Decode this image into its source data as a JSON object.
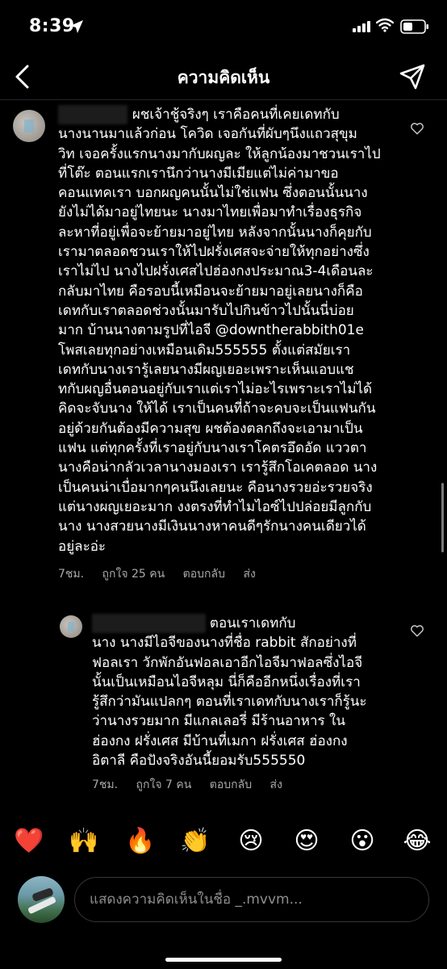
{
  "status_bar": {
    "time": "8:39"
  },
  "nav": {
    "title": "ความคิดเห็น"
  },
  "comments": [
    {
      "username_mask": "                ",
      "text": " ผชเจ้าชู้จริงๆ เราคือคนที่เคยเดทกับ\nนางนานมาแล้วก่อน โควิด เจอกันที่ผับๆนึงแถวสุขุม\nวิท เจอครั้งแรกนางมากับผญละ ให้ลูกน้องมาชวนเราไป\nที่โต๊ะ ตอนแรกเรานึกว่านางมีเมียแต่ไม่ค่ามาขอ\nคอนแทคเรา บอกผญคนนั้นไม่ใช่แฟน ซึ่งตอนนั้นนาง\nยังไม่ได้มาอยู่ไทยนะ นางมาไทยเพื่อมาทำเรื่องธุรกิจ\nละหาที่อยู่เพื่อจะย้ายมาอยู่ไทย หลังจากนั้นนางก็คุยกับ\nเรามาตลอดชวนเราให้ไปฝรั่งเศสจะจ่ายให้ทุกอย่างซึ่ง\nเราไม่ไป นางไปฝรั่งเศสไปฮ่องกงประมาณ3-4เดือนละ\nกลับมาไทย คือรอบนี้เหมือนจะย้ายมาอยู่เลยนางก็คือ\nเดทกับเราตลอดช่วงนั้นมารับไปกินข้าวไปนั้นนี่บ่อย\nมาก บ้านนางตามรูปที่ไอจี @downtherabbith01e\nโพสเลยทุกอย่างเหมือนเดิม555555 ตั้งแต่สมัยเรา\nเดทกับนางเรารู้เลยนางมีผญเยอะเพราะเห็นแอบแช\nทกับผญอื่นตอนอยู่กับเราแต่เราไม่อะไรเพราะเราไม่ได้\nคิดจะจับนาง ให้ได้ เราเป็นคนที่ถ้าจะคบจะเป็นแฟนกัน\nอยู่ด้วยกันต้องมีความสุข ผชต้องตลกถึงจะเอามาเป็น\nแฟน แต่ทุกครั้งที่เราอยู่กับนางเราโคตรอึดอัด แววตา\nนางคือน่ากลัวเวลานางมองเรา เรารู้สึกโอเคตลอด นาง\nเป็นคนน่าเบื่อมากๆคนนึงเลยนะ คือนางรวยอ่ะรวยจริง\nแต่นางผญเยอะมาก งงตรงที่ทำไมไอซ์ไปปล่อยมีลูกกับ\nนาง นางสวยนางมีเงินนางหาคนดีๆรักนางคนเดียวได้\nอยู่ละอ่ะ",
      "time": "7ชม.",
      "likes": "ถูกใจ 25 คน",
      "reply": "ตอบกลับ",
      "send": "ส่ง"
    },
    {
      "username_mask": "                          ",
      "text": " ตอนเราเดทกับ\nนาง นางมีไอจีของนางที่ชื่อ rabbit สักอย่างที่\nฟอลเรา วักพักอันฟอลเอาอีกไอจีมาฟอลซึ่งไอจี\nนั้นเป็นเหมือนไอจีหลุม นี่ก็คืออีกหนึ่งเรื่องที่เรา\nรู้สึกว่ามันแปลกๆ ตอนที่เราเดทกับนางเราก็รู้นะ\nว่านางรวยมาก มีแกลเลอรี่ มีร้านอาหาร ใน\nฮ่องกง ฝรั่งเศส มีบ้านที่เมกา ฝรั่งเศส ฮ่องกง\nอิตาลี คือปังจริงอันนี้ยอมรับ555550",
      "time": "7ชม.",
      "likes": "ถูกใจ 7 คน",
      "reply": "ตอบกลับ",
      "send": "ส่ง"
    }
  ],
  "emojis": [
    "❤️",
    "🙌",
    "🔥",
    "👏",
    "😢",
    "😍",
    "😮",
    "😂"
  ],
  "composer": {
    "placeholder": "แสดงความคิดเห็นในชื่อ _.mvvm..."
  }
}
